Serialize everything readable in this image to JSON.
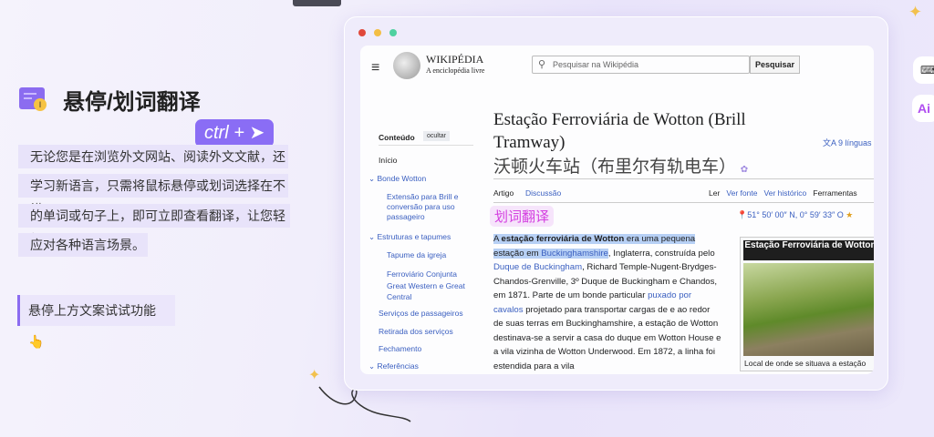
{
  "feature": {
    "title": "悬停/划词翻译",
    "shortcut": "ctrl +",
    "description_lines": [
      "无论您是在浏览外文网站、阅读外文文献，还是",
      "学习新语言，只需将鼠标悬停或划词选择在不懂",
      "的单词或句子上，即可立即查看翻译，让您轻松",
      "应对各种语言场景。"
    ],
    "hint": "悬停上方文案试试功能",
    "hint_emoji": "👆"
  },
  "wiki": {
    "wordmark": "WIKIPÉDIA",
    "tagline": "A enciclopédia livre",
    "search_placeholder": "Pesquisar na Wikipédia",
    "search_button": "Pesquisar",
    "toc": {
      "heading": "Conteúdo",
      "hide": "ocultar",
      "items": [
        "Início",
        "Bonde Wotton",
        "Extensão para Brill e conversão para uso passageiro",
        "Estruturas e tapumes",
        "Tapume da igreja",
        "Ferroviário Conjunta Great Western e Great Central",
        "Serviços de passageiros",
        "Retirada dos serviços",
        "Fechamento",
        "Referências"
      ]
    },
    "title": "Estação Ferroviária de Wotton (Brill Tramway)",
    "title_translation": "沃顿火车站（布里尔有轨电车）",
    "languages": "9 línguas",
    "tabs": [
      "Artigo",
      "Discussão"
    ],
    "actions": [
      "Ler",
      "Ver fonte",
      "Ver histórico",
      "Ferramentas"
    ],
    "coordinates": "51° 50′ 00″ N, 0° 59′ 33″ O",
    "selection_badge": "划词翻译",
    "paragraph": {
      "p1": "A ",
      "bold": "estação ferroviária de Wotton",
      "p2": " era uma pequena estação em ",
      "link1": "Buckinghamshire",
      "p3": ", Inglaterra, construída pelo ",
      "link2": "Duque de Buckingham",
      "p4": ", Richard Temple-Nugent-Brydges-Chandos-Grenville, 3º Duque de Buckingham e Chandos, em 1871. Parte de um bonde particular ",
      "link3": "puxado por cavalos",
      "p5": " projetado para transportar cargas de e ao redor de suas terras em Buckinghamshire, a estação de Wotton destinava-se a servir a casa do duque em Wotton House e a vila vizinha de Wotton Underwood. Em 1872, a linha foi estendida para a vila"
    },
    "infobox_title": "Estação Ferroviária de Wotton",
    "infobox_caption": "Local de onde se situava a estação"
  },
  "colors": {
    "accent": "#8b6cf0",
    "link": "#3a5fc0",
    "selection": "#b7d0f5",
    "badge": "#d43fe0"
  }
}
